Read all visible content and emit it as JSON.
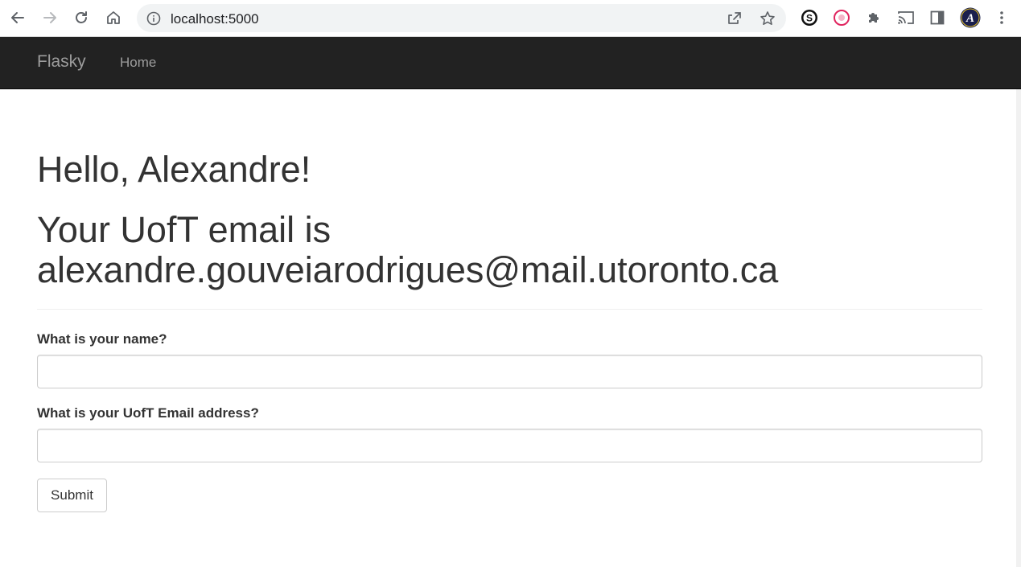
{
  "browser": {
    "url": "localhost:5000",
    "icons": [
      "back-icon",
      "forward-icon",
      "reload-icon",
      "home-icon",
      "site-info-icon",
      "share-icon",
      "bookmark-star-icon",
      "extension-s-icon",
      "extension-record-icon",
      "extensions-puzzle-icon",
      "cast-icon",
      "side-panel-icon",
      "profile-avatar-icon",
      "menu-kebab-icon"
    ],
    "profile_initial": "A"
  },
  "navbar": {
    "brand": "Flasky",
    "links": [
      {
        "label": "Home"
      }
    ]
  },
  "main": {
    "greeting": "Hello, Alexandre!",
    "email_line": "Your UofT email is alexandre.gouveiarodrigues@mail.utoronto.ca",
    "form": {
      "name_label": "What is your name?",
      "name_value": "",
      "email_label": "What is your UofT Email address?",
      "email_value": "",
      "submit_label": "Submit"
    }
  },
  "colors": {
    "navbar_bg": "#222222",
    "navbar_text": "#9d9d9d",
    "text": "#333333",
    "omnibox_bg": "#f1f3f4"
  }
}
